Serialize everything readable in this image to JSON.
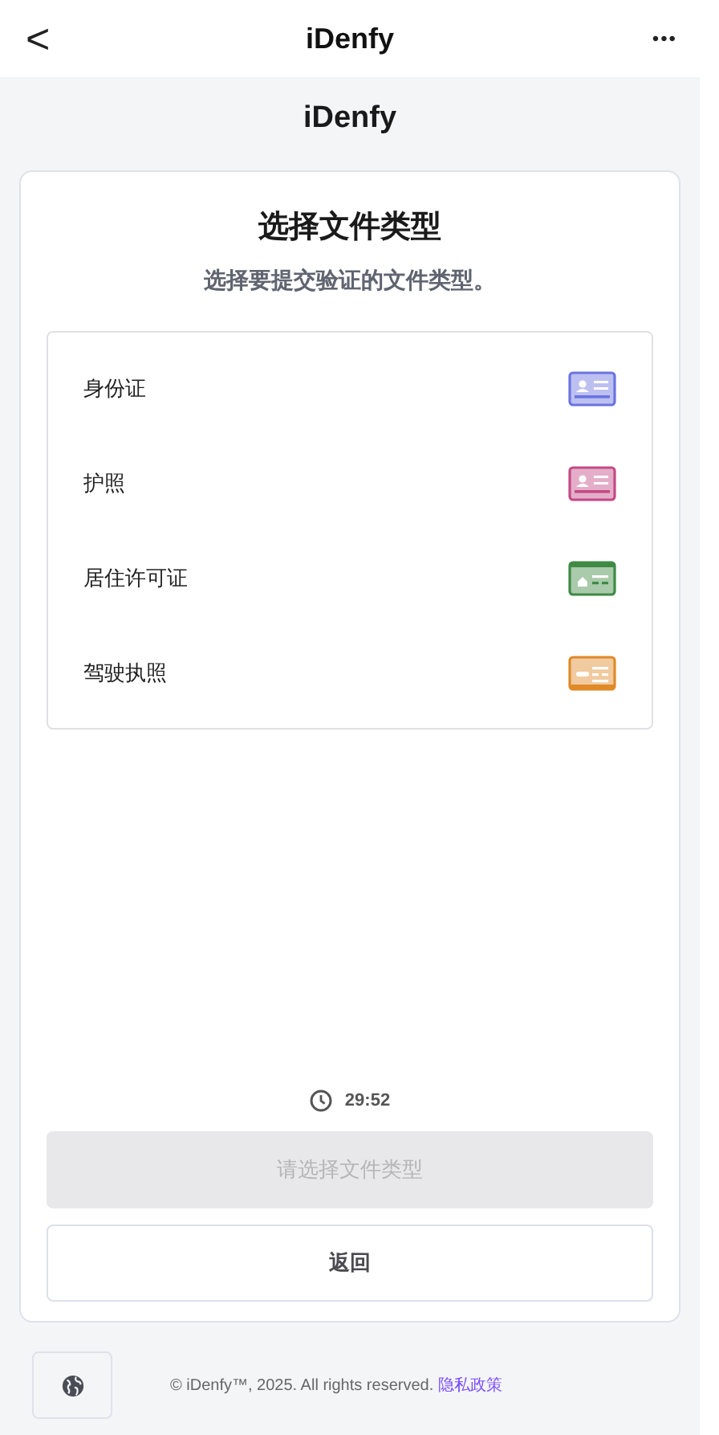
{
  "top_bar": {
    "back": "<",
    "title": "iDenfy",
    "more": "•••"
  },
  "logo": "iDenfy",
  "card": {
    "title": "选择文件类型",
    "subtitle": "选择要提交验证的文件类型。",
    "documents": [
      {
        "label": "身份证",
        "kind": "person",
        "color": "#6b74e0"
      },
      {
        "label": "护照",
        "kind": "person",
        "color": "#c44a86"
      },
      {
        "label": "居住许可证",
        "kind": "home",
        "color": "#3f8a45"
      },
      {
        "label": "驾驶执照",
        "kind": "car",
        "color": "#e08a2a"
      }
    ],
    "timer": "29:52",
    "continue_button": {
      "label": "请选择文件类型",
      "disabled": true
    },
    "back_button": "返回"
  },
  "footer": {
    "copyright": "© iDenfy™, 2025. All rights reserved.",
    "privacy_link": "隐私政策"
  }
}
